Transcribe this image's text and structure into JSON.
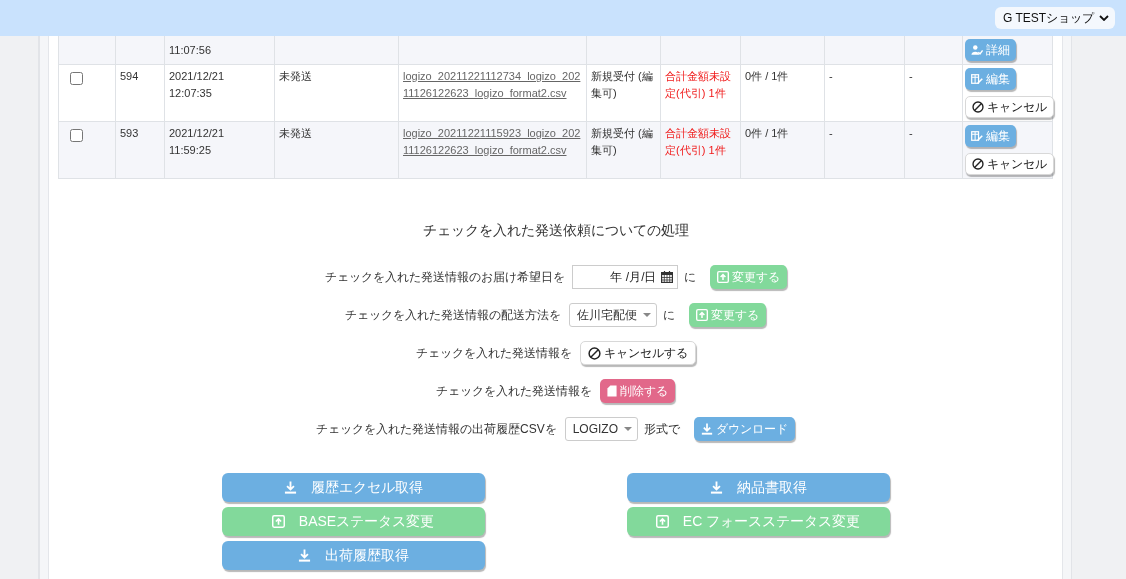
{
  "header": {
    "shop_select": {
      "value": "G TESTショップ"
    }
  },
  "table": {
    "rows": [
      {
        "time": "11:07:56",
        "actions": [
          {
            "kind": "detail",
            "label": "詳細"
          }
        ]
      },
      {
        "checked": false,
        "number": "594",
        "date": "2021/12/21",
        "time": "12:07:35",
        "status": "未発送",
        "file": "logizo_20211221112734_logizo_20211126122623_logizo_format2.csv",
        "reception": "新規受付 (編集可)",
        "amount": "合計金額未設定(代引) 1件",
        "amount_alert": true,
        "count": "0件 / 1件",
        "column_9": "-",
        "column_10": "-",
        "actions": [
          {
            "kind": "edit",
            "label": "編集"
          },
          {
            "kind": "cancel",
            "label": "キャンセル"
          }
        ]
      },
      {
        "checked": false,
        "number": "593",
        "date": "2021/12/21",
        "time": "11:59:25",
        "status": "未発送",
        "file": "logizo_20211221115923_logizo_20211126122623_logizo_format2.csv",
        "reception": "新規受付 (編集可)",
        "amount": "合計金額未設定(代引) 1件",
        "amount_alert": true,
        "count": "0件 / 1件",
        "column_9": "-",
        "column_10": "-",
        "actions": [
          {
            "kind": "edit",
            "label": "編集"
          },
          {
            "kind": "cancel",
            "label": "キャンセル"
          }
        ]
      }
    ]
  },
  "bulk_actions": {
    "title": "チェックを入れた発送依頼についての処理",
    "rows": [
      {
        "label": "チェックを入れた発送情報のお届け希望日を",
        "control": {
          "kind": "date",
          "placeholder": "年 /月/日"
        },
        "suffix": "に",
        "button": {
          "kind": "upload",
          "label": "変更する"
        }
      },
      {
        "label": "チェックを入れた発送情報の配送方法を",
        "control": {
          "kind": "select",
          "value": "佐川宅配便"
        },
        "suffix": "に",
        "button": {
          "kind": "upload",
          "label": "変更する"
        }
      },
      {
        "label": "チェックを入れた発送情報を",
        "button": {
          "kind": "cancel",
          "label": "キャンセルする"
        }
      },
      {
        "label": "チェックを入れた発送情報を",
        "button": {
          "kind": "delete",
          "label": "削除する"
        }
      },
      {
        "label": "チェックを入れた発送情報の出荷履歴CSVを",
        "control": {
          "kind": "select",
          "value": "LOGIZO"
        },
        "suffix": "形式で",
        "button": {
          "kind": "download",
          "label": "ダウンロード"
        }
      }
    ]
  },
  "export_buttons": {
    "left": [
      {
        "kind": "download",
        "label": "履歴エクセル取得"
      },
      {
        "kind": "upload",
        "label": "BASEステータス変更"
      },
      {
        "kind": "download",
        "label": "出荷履歴取得"
      }
    ],
    "right": [
      {
        "kind": "download",
        "label": "納品書取得"
      },
      {
        "kind": "upload",
        "label": "EC フォースステータス変更"
      }
    ]
  }
}
